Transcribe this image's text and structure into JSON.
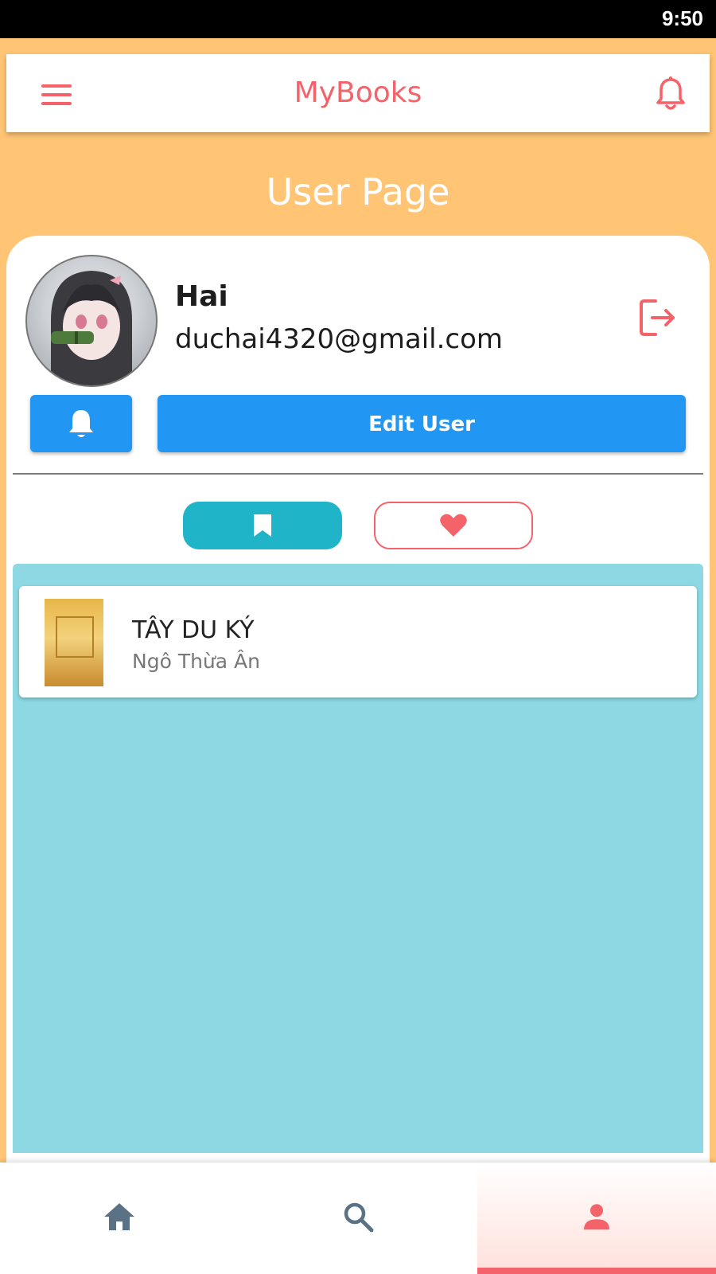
{
  "status_bar": {
    "time": "9:50"
  },
  "app_bar": {
    "title": "MyBooks",
    "menu_icon": "hamburger-menu-icon",
    "notification_icon": "bell-icon",
    "accent": "#F4626A"
  },
  "page": {
    "title": "User Page"
  },
  "user": {
    "name": "Hai",
    "email": "duchai4320@gmail.com",
    "logout_icon": "logout-icon",
    "notify_button_icon": "bell-icon",
    "edit_label": "Edit User"
  },
  "tabs": [
    {
      "icon": "bookmark-icon",
      "active": true
    },
    {
      "icon": "heart-icon",
      "active": false
    }
  ],
  "books": [
    {
      "title": "TÂY DU KÝ",
      "author": "Ngô Thừa Ân"
    }
  ],
  "bottom_nav": [
    {
      "icon": "home-icon",
      "active": false
    },
    {
      "icon": "search-icon",
      "active": false
    },
    {
      "icon": "user-icon",
      "active": true
    }
  ],
  "colors": {
    "background": "#FFC575",
    "primary_button": "#2196F3",
    "tab_active": "#20B4C9",
    "list_background": "#8DD8E2",
    "accent": "#F4626A"
  }
}
